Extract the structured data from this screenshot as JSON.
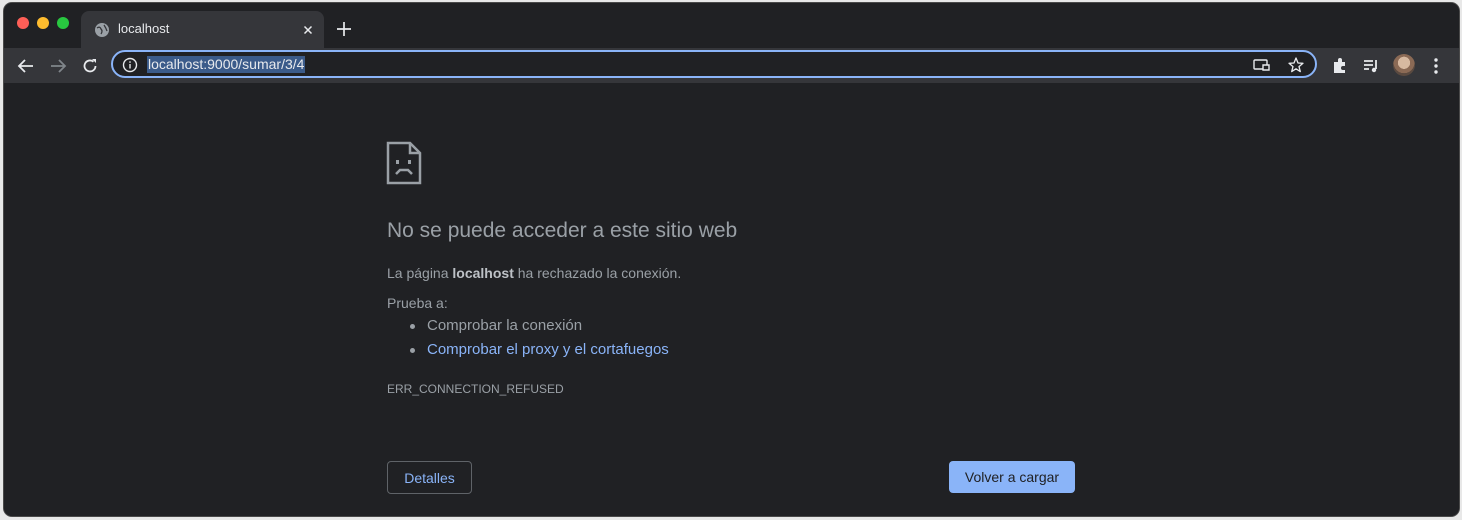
{
  "browser": {
    "tab": {
      "title": "localhost",
      "favicon": "globe-icon"
    },
    "url": "localhost:9000/sumar/3/4"
  },
  "error_page": {
    "heading": "No se puede acceder a este sitio web",
    "message_prefix": "La página ",
    "message_host": "localhost",
    "message_suffix": " ha rechazado la conexión.",
    "try_label": "Prueba a:",
    "suggestions": [
      {
        "text": "Comprobar la conexión",
        "link": false
      },
      {
        "text": "Comprobar el proxy y el cortafuegos",
        "link": true
      }
    ],
    "error_code": "ERR_CONNECTION_REFUSED",
    "details_button": "Detalles",
    "reload_button": "Volver a cargar"
  },
  "colors": {
    "background": "#202124",
    "toolbar": "#35363a",
    "accent": "#8ab4f8",
    "text": "#9aa0a6"
  }
}
